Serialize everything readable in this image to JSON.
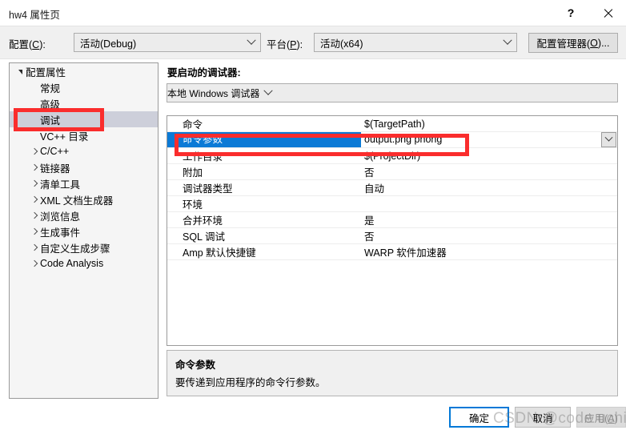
{
  "window": {
    "title": "hw4 属性页",
    "help_icon": "?",
    "close_icon": "close-icon"
  },
  "topbar": {
    "config_label_pre": "配置(",
    "config_label_key": "C",
    "config_label_post": "):",
    "config_value": "活动(Debug)",
    "platform_label_pre": "平台(",
    "platform_label_key": "P",
    "platform_label_post": "):",
    "platform_value": "活动(x64)",
    "config_manager_pre": "配置管理器(",
    "config_manager_key": "O",
    "config_manager_post": ")..."
  },
  "sidebar": {
    "items": [
      {
        "label": "配置属性",
        "indent": 0,
        "expander": "down",
        "selected": false
      },
      {
        "label": "常规",
        "indent": 1,
        "expander": "none",
        "selected": false
      },
      {
        "label": "高级",
        "indent": 1,
        "expander": "none",
        "selected": false
      },
      {
        "label": "调试",
        "indent": 1,
        "expander": "none",
        "selected": true
      },
      {
        "label": "VC++ 目录",
        "indent": 1,
        "expander": "none",
        "selected": false
      },
      {
        "label": "C/C++",
        "indent": 1,
        "expander": "right",
        "selected": false
      },
      {
        "label": "链接器",
        "indent": 1,
        "expander": "right",
        "selected": false
      },
      {
        "label": "清单工具",
        "indent": 1,
        "expander": "right",
        "selected": false
      },
      {
        "label": "XML 文档生成器",
        "indent": 1,
        "expander": "right",
        "selected": false
      },
      {
        "label": "浏览信息",
        "indent": 1,
        "expander": "right",
        "selected": false
      },
      {
        "label": "生成事件",
        "indent": 1,
        "expander": "right",
        "selected": false
      },
      {
        "label": "自定义生成步骤",
        "indent": 1,
        "expander": "right",
        "selected": false
      },
      {
        "label": "Code Analysis",
        "indent": 1,
        "expander": "right",
        "selected": false
      }
    ]
  },
  "main": {
    "debugger_caption": "要启动的调试器:",
    "debugger_value": "本地 Windows 调试器",
    "properties": [
      {
        "name": "命令",
        "value": "$(TargetPath)",
        "selected": false
      },
      {
        "name": "命令参数",
        "value": "output.png phong",
        "selected": true
      },
      {
        "name": "工作目录",
        "value": "$(ProjectDir)",
        "selected": false
      },
      {
        "name": "附加",
        "value": "否",
        "selected": false
      },
      {
        "name": "调试器类型",
        "value": "自动",
        "selected": false
      },
      {
        "name": "环境",
        "value": "",
        "selected": false
      },
      {
        "name": "合并环境",
        "value": "是",
        "selected": false
      },
      {
        "name": "SQL 调试",
        "value": "否",
        "selected": false
      },
      {
        "name": "Amp 默认快捷键",
        "value": "WARP 软件加速器",
        "selected": false
      }
    ],
    "description": {
      "title": "命令参数",
      "body": "要传递到应用程序的命令行参数。"
    }
  },
  "footer": {
    "ok": "确定",
    "cancel": "取消",
    "apply_pre": "应用(",
    "apply_key": "A",
    "apply_post": ")"
  },
  "watermark": "CSDN @code uchina",
  "colors": {
    "selection_blue": "#0b7ad6",
    "tree_selection_gray": "#cdcfda",
    "annotation_red": "#fa2d2d",
    "focus_border_blue": "#0078d7"
  }
}
